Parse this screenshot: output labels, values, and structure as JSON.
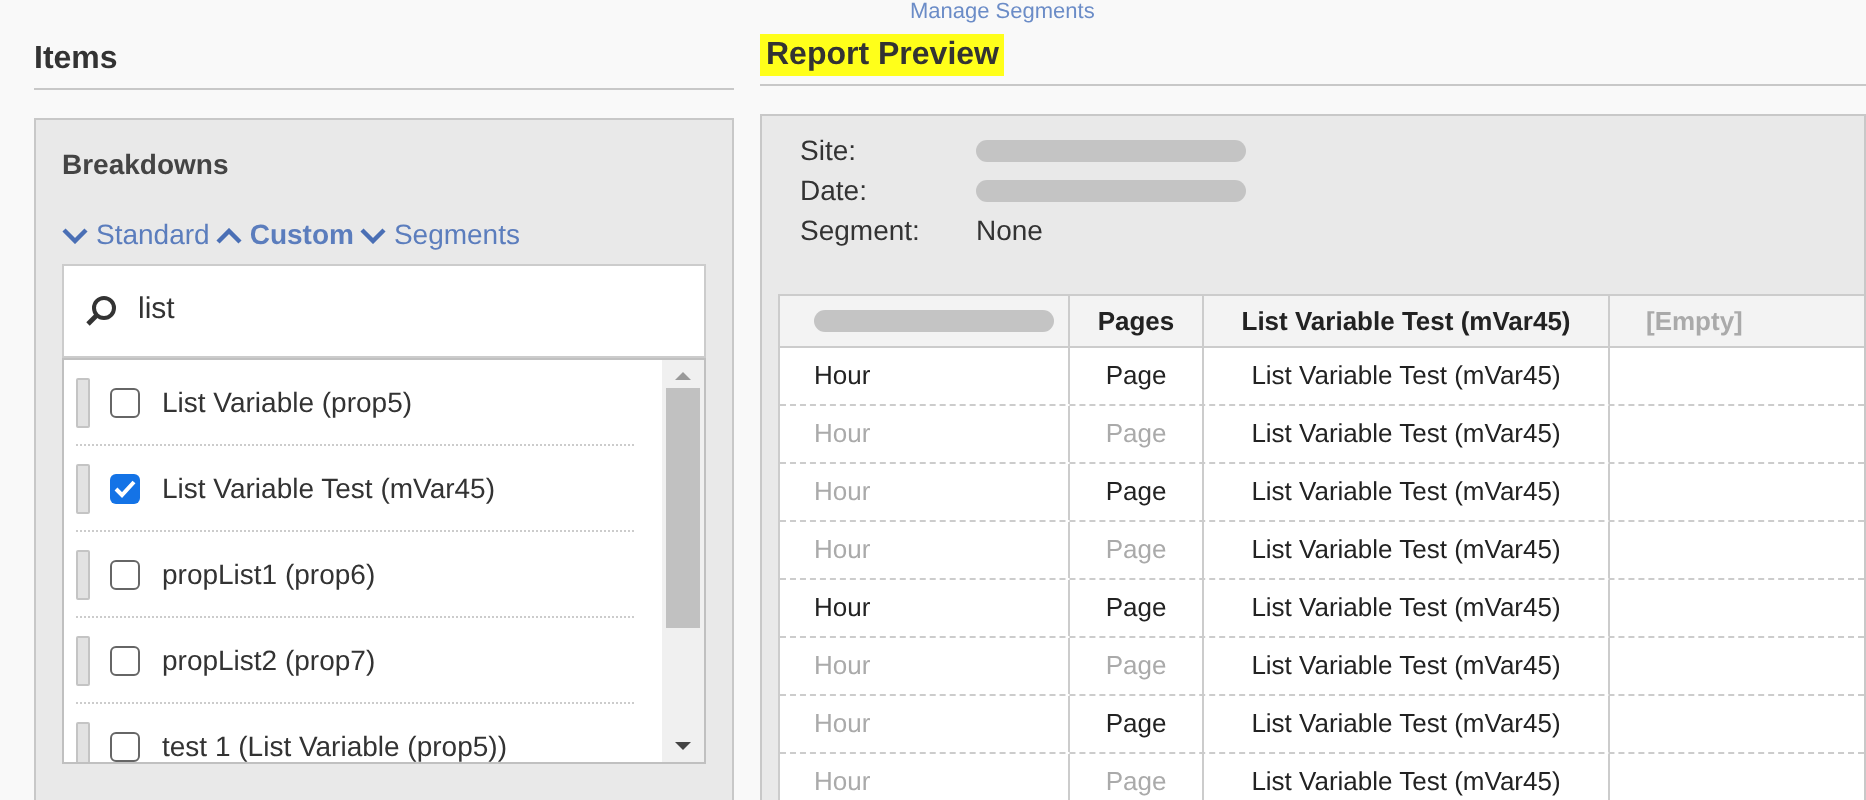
{
  "top_link": "Manage Segments",
  "items_panel": {
    "title": "Items",
    "subtitle": "Breakdowns",
    "tabs": [
      {
        "label": "Standard",
        "selected": false
      },
      {
        "label": "Custom",
        "selected": true
      },
      {
        "label": "Segments",
        "selected": false
      }
    ],
    "search": {
      "value": "list"
    },
    "list": [
      {
        "label": "List Variable (prop5)",
        "checked": false
      },
      {
        "label": "List Variable Test (mVar45)",
        "checked": true
      },
      {
        "label": "propList1 (prop6)",
        "checked": false
      },
      {
        "label": "propList2 (prop7)",
        "checked": false
      },
      {
        "label": "test 1 (List Variable (prop5))",
        "checked": false
      }
    ]
  },
  "report_preview": {
    "title": "Report Preview",
    "info": [
      {
        "label": "Site:",
        "redacted": true
      },
      {
        "label": "Date:",
        "redacted": true
      },
      {
        "label": "Segment:",
        "value": "None",
        "redacted": false
      }
    ],
    "table": {
      "columns": [
        {
          "redacted": true
        },
        {
          "label": "Pages"
        },
        {
          "label": "List Variable Test (mVar45)"
        },
        {
          "label": "[Empty]"
        }
      ],
      "rows": [
        {
          "hour": "Hour",
          "hour_dimmed": false,
          "page": "Page",
          "page_dimmed": false,
          "variable": "List Variable Test (mVar45)"
        },
        {
          "hour": "Hour",
          "hour_dimmed": true,
          "page": "Page",
          "page_dimmed": true,
          "variable": "List Variable Test (mVar45)"
        },
        {
          "hour": "Hour",
          "hour_dimmed": true,
          "page": "Page",
          "page_dimmed": false,
          "variable": "List Variable Test (mVar45)"
        },
        {
          "hour": "Hour",
          "hour_dimmed": true,
          "page": "Page",
          "page_dimmed": true,
          "variable": "List Variable Test (mVar45)"
        },
        {
          "hour": "Hour",
          "hour_dimmed": false,
          "page": "Page",
          "page_dimmed": false,
          "variable": "List Variable Test (mVar45)"
        },
        {
          "hour": "Hour",
          "hour_dimmed": true,
          "page": "Page",
          "page_dimmed": true,
          "variable": "List Variable Test (mVar45)"
        },
        {
          "hour": "Hour",
          "hour_dimmed": true,
          "page": "Page",
          "page_dimmed": false,
          "variable": "List Variable Test (mVar45)"
        },
        {
          "hour": "Hour",
          "hour_dimmed": true,
          "page": "Page",
          "page_dimmed": true,
          "variable": "List Variable Test (mVar45)"
        }
      ]
    }
  }
}
